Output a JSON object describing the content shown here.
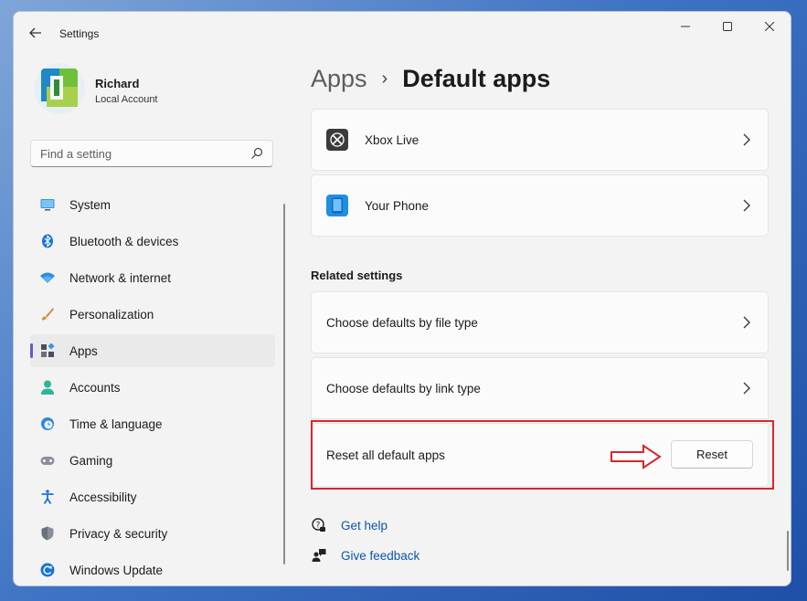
{
  "window": {
    "title": "Settings",
    "controls": [
      "minimize",
      "maximize",
      "close"
    ]
  },
  "profile": {
    "name": "Richard",
    "account_type": "Local Account"
  },
  "search": {
    "placeholder": "Find a setting",
    "value": ""
  },
  "sidebar": {
    "items": [
      {
        "label": "System",
        "icon": "monitor-icon",
        "active": false
      },
      {
        "label": "Bluetooth & devices",
        "icon": "bluetooth-icon",
        "active": false
      },
      {
        "label": "Network & internet",
        "icon": "wifi-icon",
        "active": false
      },
      {
        "label": "Personalization",
        "icon": "brush-icon",
        "active": false
      },
      {
        "label": "Apps",
        "icon": "apps-icon",
        "active": true
      },
      {
        "label": "Accounts",
        "icon": "person-icon",
        "active": false
      },
      {
        "label": "Time & language",
        "icon": "clock-globe-icon",
        "active": false
      },
      {
        "label": "Gaming",
        "icon": "gamepad-icon",
        "active": false
      },
      {
        "label": "Accessibility",
        "icon": "accessibility-icon",
        "active": false
      },
      {
        "label": "Privacy & security",
        "icon": "shield-icon",
        "active": false
      },
      {
        "label": "Windows Update",
        "icon": "update-icon",
        "active": false
      }
    ]
  },
  "breadcrumb": {
    "parent": "Apps",
    "separator": "›",
    "current": "Default apps"
  },
  "app_list": [
    {
      "label": "Xbox Live",
      "icon": "xbox-icon"
    },
    {
      "label": "Your Phone",
      "icon": "phone-icon"
    }
  ],
  "related": {
    "title": "Related settings",
    "file_type": "Choose defaults by file type",
    "link_type": "Choose defaults by link type",
    "reset_label": "Reset all default apps",
    "reset_button": "Reset"
  },
  "help": {
    "get_help": "Get help",
    "give_feedback": "Give feedback"
  },
  "colors": {
    "accent": "#5b5fc7",
    "link": "#0c55a8",
    "annotation": "#d9262c"
  }
}
